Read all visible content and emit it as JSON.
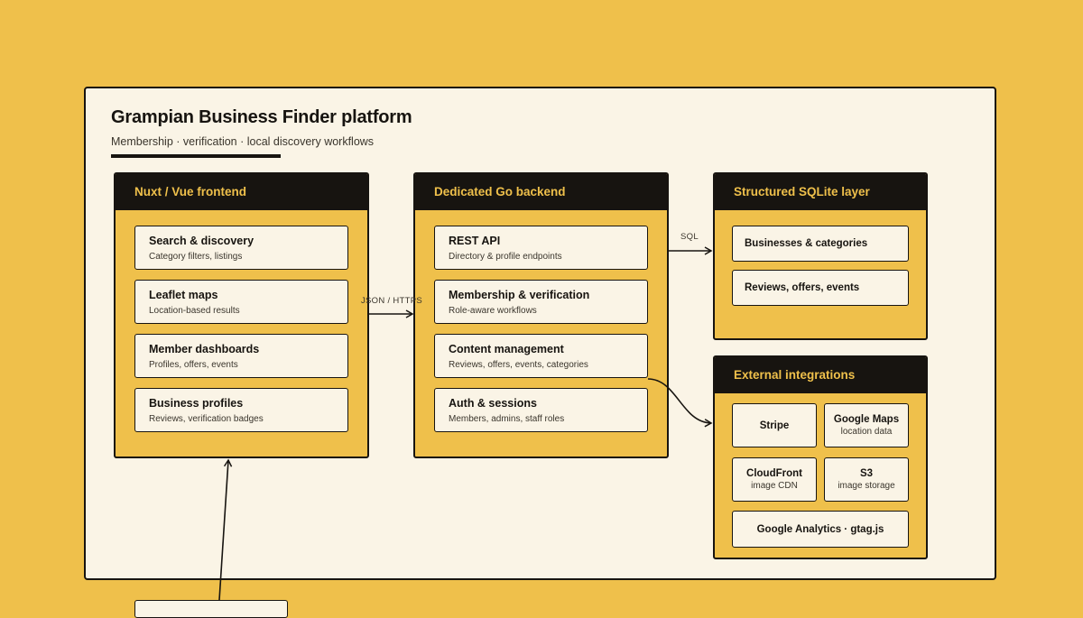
{
  "title": "Grampian Business Finder platform",
  "subtitle": "Membership · verification · local discovery workflows",
  "frontend": {
    "title": "Nuxt / Vue frontend",
    "items": [
      {
        "title": "Search & discovery",
        "sub": "Category filters, listings"
      },
      {
        "title": "Leaflet maps",
        "sub": "Location-based results"
      },
      {
        "title": "Member dashboards",
        "sub": "Profiles, offers, events"
      },
      {
        "title": "Business profiles",
        "sub": "Reviews, verification badges"
      }
    ]
  },
  "backend": {
    "title": "Dedicated Go backend",
    "items": [
      {
        "title": "REST API",
        "sub": "Directory & profile endpoints"
      },
      {
        "title": "Membership & verification",
        "sub": "Role-aware workflows"
      },
      {
        "title": "Content management",
        "sub": "Reviews, offers, events, categories"
      },
      {
        "title": "Auth & sessions",
        "sub": "Members, admins, staff roles"
      }
    ]
  },
  "database": {
    "title": "Structured SQLite layer",
    "items": [
      "Businesses & categories",
      "Reviews, offers, events"
    ]
  },
  "integrations": {
    "title": "External integrations",
    "stripe": {
      "title": "Stripe"
    },
    "google_maps": {
      "title": "Google Maps",
      "sub": "location data"
    },
    "cloudfront": {
      "title": "CloudFront",
      "sub": "image CDN"
    },
    "s3": {
      "title": "S3",
      "sub": "image storage"
    },
    "analytics": {
      "title": "Google Analytics · gtag.js"
    }
  },
  "connections": {
    "frontend_backend": "JSON / HTTPS",
    "backend_db": "SQL"
  },
  "colors": {
    "background": "#efc04b",
    "card": "#faf4e6",
    "ink": "#171410",
    "header_text": "#efc04b"
  }
}
